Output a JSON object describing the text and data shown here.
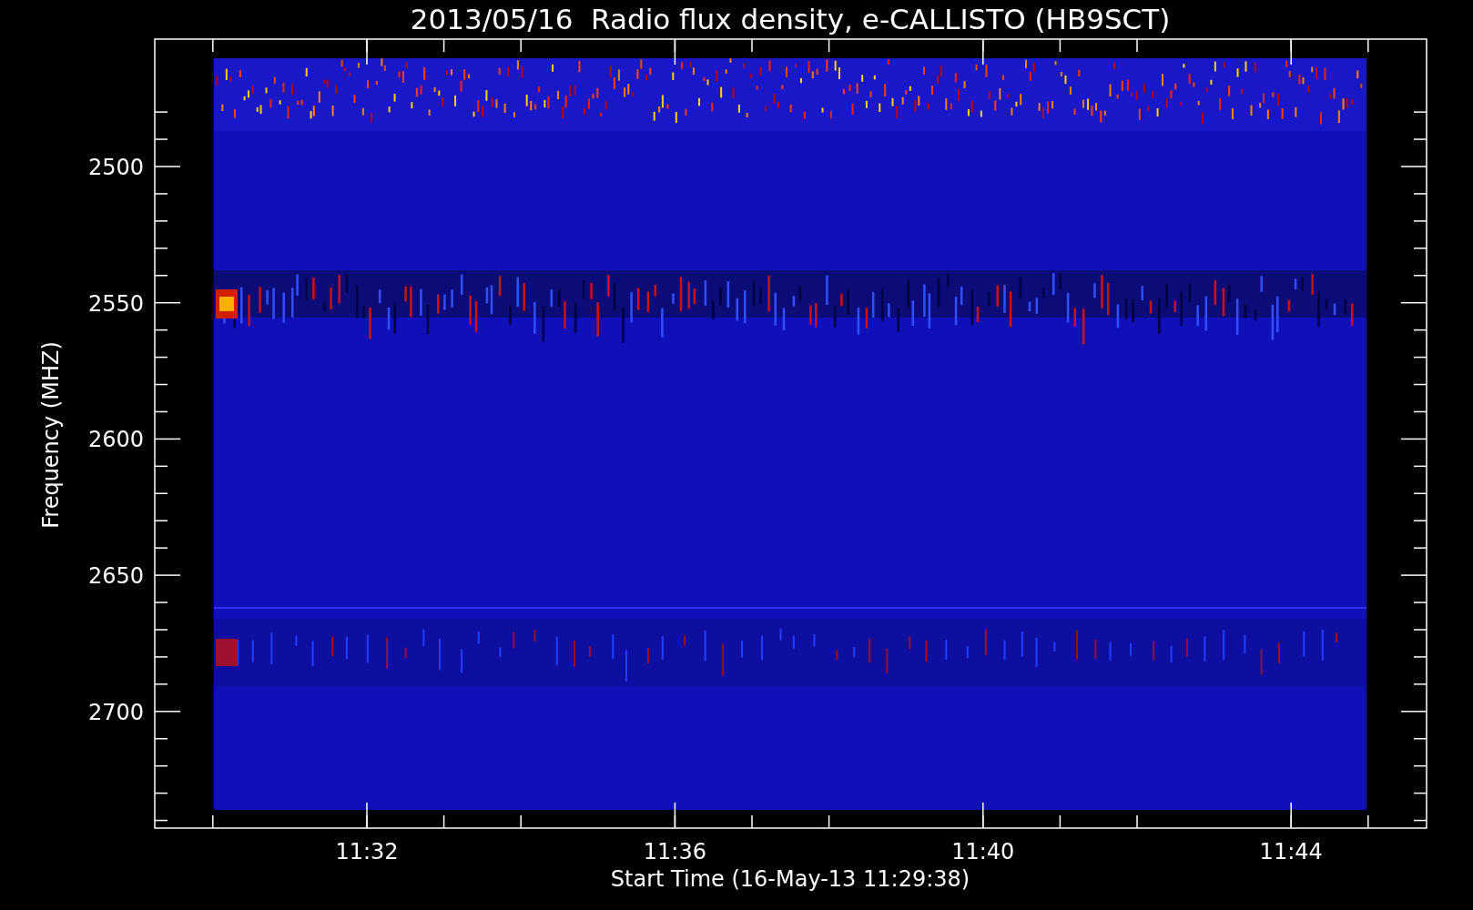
{
  "title": "2013/05/16  Radio flux density, e-CALLISTO (HB9SCT)",
  "y_axis": {
    "label": "Frequency (MHZ)",
    "ticks": [
      "2500",
      "2550",
      "2600",
      "2650",
      "2700"
    ]
  },
  "x_axis": {
    "label": "Start Time (16-May-13 11:29:38)",
    "ticks": [
      "11:32",
      "11:36",
      "11:40",
      "11:44"
    ]
  }
}
